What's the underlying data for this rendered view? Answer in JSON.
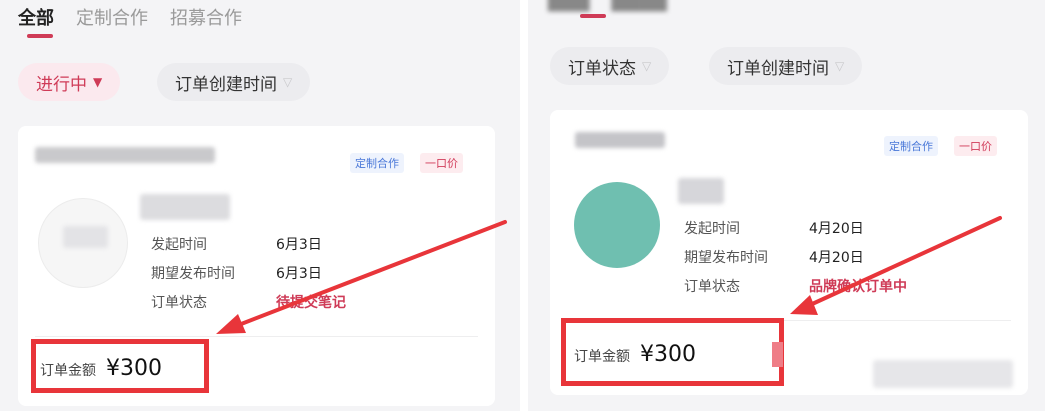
{
  "left": {
    "tabs": [
      "全部",
      "定制合作",
      "招募合作"
    ],
    "filters": [
      {
        "label": "进行中",
        "active": true
      },
      {
        "label": "订单创建时间",
        "active": false
      }
    ],
    "card": {
      "badges": [
        "定制合作",
        "一口价"
      ],
      "rows": [
        {
          "label": "发起时间",
          "value": "6月3日"
        },
        {
          "label": "期望发布时间",
          "value": "6月3日"
        },
        {
          "label": "订单状态",
          "value": "待提交笔记"
        }
      ],
      "amount_label": "订单金额",
      "amount_value": "¥300"
    }
  },
  "right": {
    "filters": [
      {
        "label": "订单状态",
        "active": false
      },
      {
        "label": "订单创建时间",
        "active": false
      }
    ],
    "card": {
      "badges": [
        "定制合作",
        "一口价"
      ],
      "rows": [
        {
          "label": "发起时间",
          "value": "4月20日"
        },
        {
          "label": "期望发布时间",
          "value": "4月20日"
        },
        {
          "label": "订单状态",
          "value": "品牌确认订单中"
        }
      ],
      "amount_label": "订单金额",
      "amount_value": "¥300"
    }
  },
  "colors": {
    "accent": "#cf3b57",
    "annotation": "#e8353a",
    "avatar_teal": "#6fbfb0"
  },
  "icons": {
    "chevron": "chevron-down-icon",
    "annotation_arrow": "arrow-icon"
  }
}
